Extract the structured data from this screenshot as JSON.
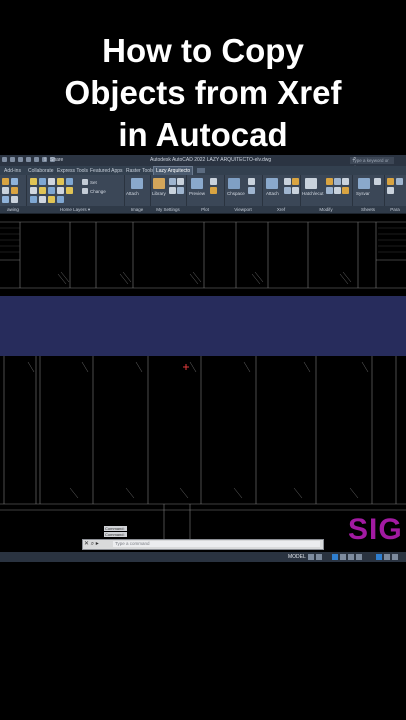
{
  "video_title": {
    "lines": [
      "How to Copy",
      "Objects from Xref",
      "in Autocad"
    ]
  },
  "titlebar": {
    "share_label": "Share",
    "window_title": "Autodesk AutoCAD 2022   LAZY ARQUITECTO-elv.dwg",
    "search_placeholder": "Type a keyword or phrase"
  },
  "ribbon_tabs": [
    {
      "label": "Add-ins"
    },
    {
      "label": "Collaborate"
    },
    {
      "label": "Express Tools"
    },
    {
      "label": "Featured Apps"
    },
    {
      "label": "Raster Tools"
    },
    {
      "label": "Lazy Arquitecto",
      "active": true
    }
  ],
  "ribbon": {
    "attach_label": "Attach",
    "library_label": "Library",
    "preview_label": "Preview",
    "chspace_label": "Chspace",
    "attach2_label": "Attach",
    "hatch_label": "Hatch/ecut",
    "sysvar_label": "Sysvar",
    "set_label": "Set",
    "change_label": "Change"
  },
  "ribbon_panels": [
    {
      "label": "awing"
    },
    {
      "label": "Home Layers ▾"
    },
    {
      "label": "Image"
    },
    {
      "label": "My Settings"
    },
    {
      "label": "Plot"
    },
    {
      "label": "Viewport"
    },
    {
      "label": "Xref"
    },
    {
      "label": "Modify"
    },
    {
      "label": "Sheets"
    },
    {
      "label": "Para"
    }
  ],
  "command_line": {
    "placeholder": "Type a command",
    "history": [
      "Command:",
      "Command:"
    ]
  },
  "status_bar": {
    "model_label": "MODEL"
  },
  "watermark": {
    "text": "SIG"
  },
  "colors": {
    "ribbon_bg": "#3b4757",
    "tab_bar_bg": "#33404f",
    "viewport_bg": "#000000",
    "band_blue": "#272c5c",
    "watermark": "#a21aa2"
  }
}
